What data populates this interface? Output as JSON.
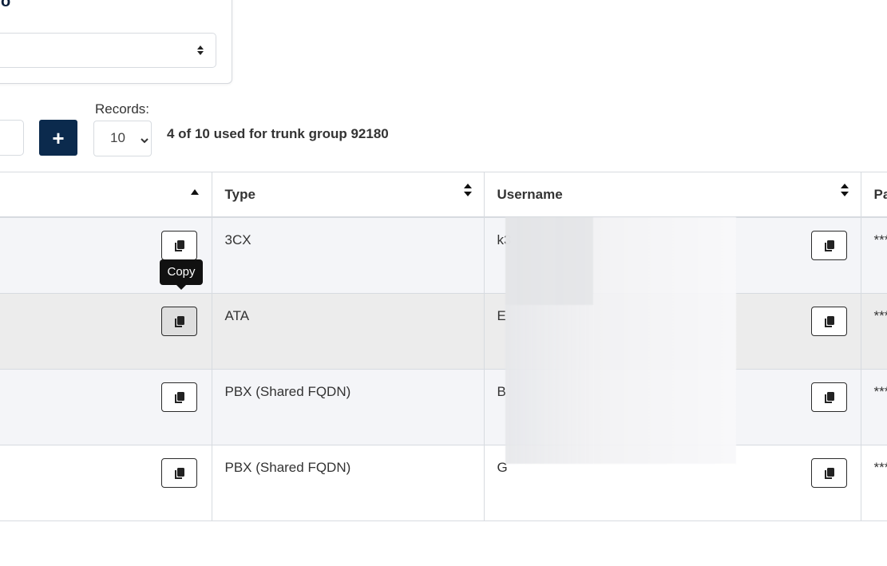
{
  "panel": {
    "title_fragment": "o"
  },
  "toolbar": {
    "add_label": "+",
    "records_label": "Records:",
    "records_value": "10",
    "usage_text": "4 of 10 used for trunk group 92180"
  },
  "table": {
    "headers": {
      "type": "Type",
      "username": "Username",
      "password": "Pa"
    },
    "rows": [
      {
        "type": "3CX",
        "username": "k3",
        "password": "***"
      },
      {
        "type": "ATA",
        "username": "E",
        "password": "***"
      },
      {
        "type": "PBX (Shared FQDN)",
        "username": "B",
        "password": "***"
      },
      {
        "type": "PBX (Shared FQDN)",
        "username": "G",
        "password": "***"
      }
    ]
  },
  "tooltip": {
    "text": "Copy"
  },
  "icons": {
    "copy": "copy-icon",
    "sort": "sort-icon",
    "sort_asc": "sort-ascending-icon",
    "chevron": "chevron-down-icon",
    "updown": "updown-icon"
  },
  "colors": {
    "accent": "#0b2a4d",
    "border": "#d7dbe0",
    "row_alt": "#f4f5f8",
    "row_hover": "#ececec"
  }
}
